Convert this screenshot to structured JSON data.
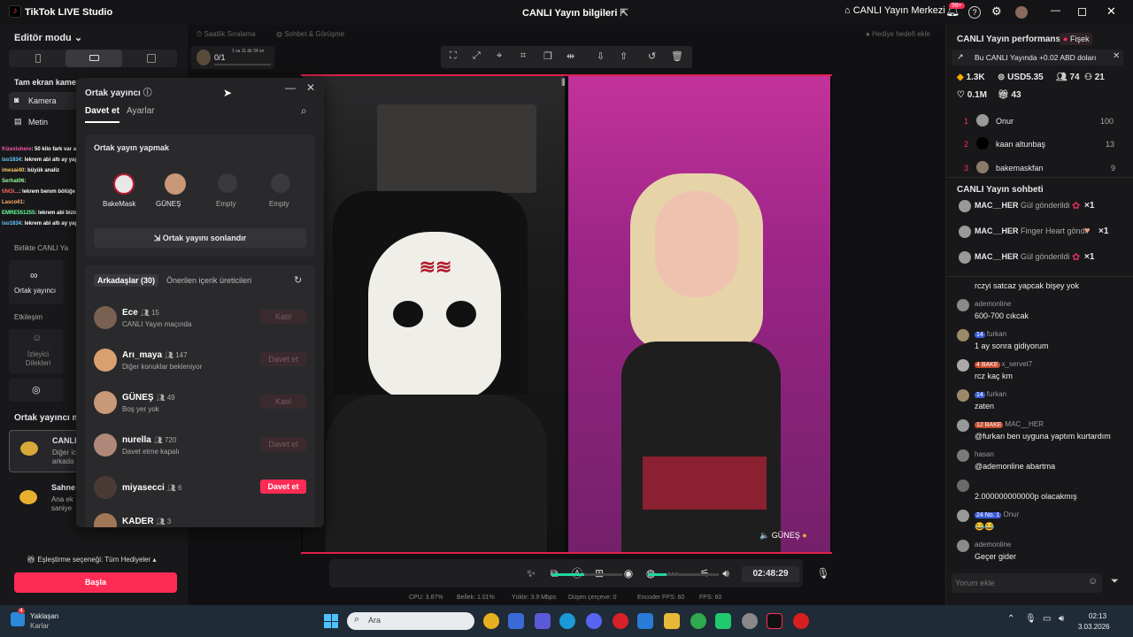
{
  "titlebar": {
    "app_name": "TikTok LIVE Studio",
    "live_info": "CANLI Yayın bilgileri",
    "live_center": "CANLI Yayın Merkezi",
    "notif_count": "99+"
  },
  "left": {
    "editor_mode": "Editör modu",
    "fullscreen_camera": "Tam ekran kamer",
    "camera": "Kamera",
    "text": "Metin",
    "together_live": "Birlikte CANLI Ya",
    "co_host": "Ortak yayıncı",
    "interaction": "Etkileşim",
    "viewer_requests": "İzleyici Dilekleri",
    "co_host_mode": "Ortak yayıncı m",
    "mode1_title": "CANLI",
    "mode1_sub1": "Diğer ic",
    "mode1_sub2": "arkada",
    "mode2_title": "Sahne",
    "mode2_sub1": "Ana ek",
    "mode2_sub2": "saniye",
    "match_option": "Eşleştirme seçeneği: Tüm Hediyeler",
    "start_button": "Başla",
    "chat_overlay": [
      {
        "user": "frizexishere",
        "text": ": 50 kilo fark var aradaksa ldk sonuç"
      },
      {
        "user": "iso1834",
        "text": ": lekrem abi altı ay yap gel gay misin tuvallet temizlicen mk bişey yapmıcan"
      },
      {
        "user": "imesai40",
        "text": ": büyük analiz"
      },
      {
        "user": "Serhat06",
        "text": ":"
      },
      {
        "user": "tiNOi...",
        "text": ": lekrem benım bölüğe gel seni kayırayım"
      },
      {
        "user": "Lasco61",
        "text": ":"
      },
      {
        "user": "EMRE551255",
        "text": ": lekrem abi bizim şu inşaat noldu güneş hanım yandaki arsa vardıya"
      },
      {
        "user": "iso1834",
        "text": ": lekrem abi altı ay yap gel gay misin tuvallet temizlicen mk bişey yapmıcan"
      }
    ]
  },
  "top_strip": {
    "weekly_rank": "Saatlik Sıralama",
    "chat_video": "Sohbet & Görüşme",
    "goal": "0/1",
    "goal_time": "1 sa 11 dk 34 sn",
    "gift_goal": "Hediye hedefi ekle"
  },
  "popup": {
    "title": "Ortak yayıncı",
    "tab_invite": "Davet et",
    "tab_settings": "Ayarlar",
    "section_title": "Ortak yayın yapmak",
    "slots": [
      {
        "name": "BakeMask"
      },
      {
        "name": "GÜNEŞ"
      },
      {
        "name": "Empty"
      },
      {
        "name": "Empty"
      }
    ],
    "end_button": "Ortak yayını sonlandır",
    "friends_tab": "Arkadaşlar (30)",
    "suggested_tab": "Önerilen içerik üreticileri",
    "friends": [
      {
        "name": "Ece",
        "count": "15",
        "status": "CANLI Yayın maçında",
        "button": "Katıl",
        "active": false
      },
      {
        "name": "Arı_maya",
        "count": "147",
        "status": "Diğer konuklar bekleniyor",
        "button": "Davet et",
        "active": false
      },
      {
        "name": "GÜNEŞ",
        "count": "49",
        "status": "Boş yer yok",
        "button": "Katıl",
        "active": false
      },
      {
        "name": "nurella",
        "count": "720",
        "status": "Davet etme kapalı",
        "button": "Davet et",
        "active": false
      },
      {
        "name": "miyasecci",
        "count": "6",
        "status": "",
        "button": "Davet et",
        "active": true
      },
      {
        "name": "KADER",
        "count": "3",
        "status": "",
        "button": "Davet et",
        "active": false
      }
    ]
  },
  "stage": {
    "guest_name": "GÜNEŞ",
    "timer": "02:48:29"
  },
  "stats_bar": {
    "cpu": "CPU: 3.87%",
    "memory": "Bellek: 1.01%",
    "upload": "Yükle: 3.9 Mbps",
    "dropped": "Düşen çerçeve: 0",
    "encoder_fps": "Encoder FPS: 60",
    "fps": "FPS: 60"
  },
  "right": {
    "performance_title": "CANLI Yayın performansı",
    "fisek": "Fişek",
    "earnings_note": "Bu CANLI Yayında +0.02 ABD doları",
    "stats": {
      "diamonds": "1.3K",
      "usd": "USD5.35",
      "viewers": "74",
      "followers": "21",
      "likes": "0.1M",
      "gifters": "43"
    },
    "ranking": [
      {
        "rank": "1",
        "name": "Onur",
        "score": "100"
      },
      {
        "rank": "2",
        "name": "kaan altunbaş",
        "score": "13"
      },
      {
        "rank": "3",
        "name": "bakemaskfan",
        "score": "9"
      }
    ],
    "chat_title": "CANLI Yayın sohbeti",
    "gifts": [
      {
        "user": "MAC__HER",
        "text": "Gül gönderildi",
        "count": "×1"
      },
      {
        "user": "MAC__HER",
        "text": "Finger Heart göndı",
        "count": "×1"
      },
      {
        "user": "MAC__HER",
        "text": "Gül gönderildi",
        "count": "×1"
      }
    ],
    "messages": [
      {
        "user": "",
        "badges": "",
        "text": "rczyi satcaz yapcak bişey yok"
      },
      {
        "user": "ademonline",
        "badges": "",
        "text": "600-700 cıkcak"
      },
      {
        "user": "furkan",
        "badges": "14",
        "text": "1 ay sonra gidiyorum"
      },
      {
        "user": "x_servet7",
        "badges": "4 BAKE",
        "text": "rcz kaç km"
      },
      {
        "user": "furkan",
        "badges": "14",
        "text": "zaten"
      },
      {
        "user": "MAC__HER",
        "badges": "12 BAKE",
        "text": "@furkan ben uyguna yaptım kurtardım"
      },
      {
        "user": "hasan",
        "badges": "",
        "text": "@ademonline abartma"
      },
      {
        "user": "",
        "badges": "",
        "text": "2.000000000000p olacakmış"
      },
      {
        "user": "Onur",
        "badges": "24 No. 1",
        "text": "😂😂"
      },
      {
        "user": "ademonline",
        "badges": "",
        "text": "Geçer gider"
      }
    ],
    "comment_placeholder": "Yorum ekle"
  },
  "taskbar": {
    "weather_title": "Yaklaşan",
    "weather_sub": "Karlar",
    "weather_badge": "4",
    "search": "Ara",
    "time": "02:13",
    "date": "3.03.2026"
  }
}
